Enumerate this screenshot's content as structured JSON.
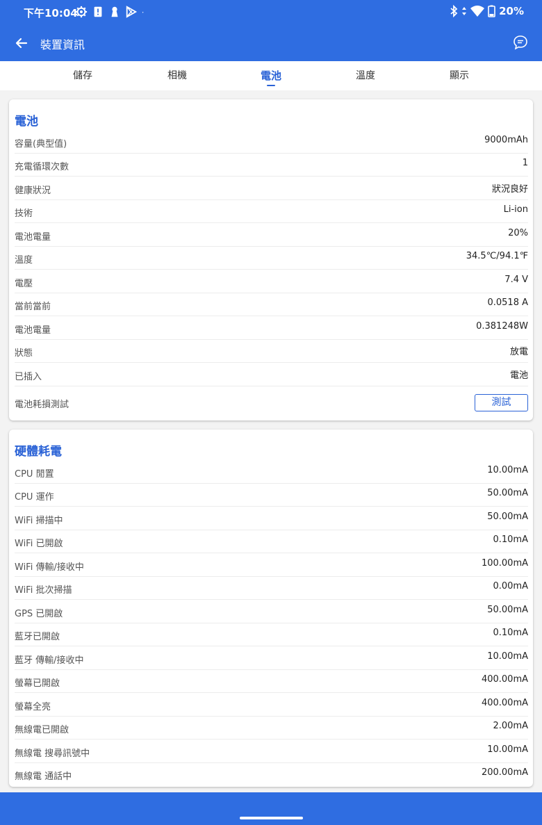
{
  "status": {
    "time": "下午10:04",
    "battery": "20%"
  },
  "app": {
    "title": "裝置資訊"
  },
  "tabs": [
    {
      "label": "儲存",
      "active": false
    },
    {
      "label": "相機",
      "active": false
    },
    {
      "label": "電池",
      "active": true
    },
    {
      "label": "溫度",
      "active": false
    },
    {
      "label": "顯示",
      "active": false
    }
  ],
  "battery": {
    "title": "電池",
    "rows": [
      {
        "label": "容量(典型值)",
        "value": "9000mAh"
      },
      {
        "label": "充電循環次數",
        "value": "1"
      },
      {
        "label": "健康狀況",
        "value": "狀況良好"
      },
      {
        "label": "技術",
        "value": "Li-ion"
      },
      {
        "label": "電池電量",
        "value": "20%"
      },
      {
        "label": "溫度",
        "value": "34.5℃/94.1℉"
      },
      {
        "label": "電壓",
        "value": "7.4 V"
      },
      {
        "label": "當前當前",
        "value": "0.0518 A"
      },
      {
        "label": "電池電量",
        "value": "0.381248W"
      },
      {
        "label": "狀態",
        "value": "放電"
      },
      {
        "label": "已插入",
        "value": "電池"
      }
    ],
    "test": {
      "label": "電池耗損測試",
      "button": "測試"
    }
  },
  "hardware": {
    "title": "硬體耗電",
    "rows": [
      {
        "label": "CPU 閒置",
        "value": "10.00mA"
      },
      {
        "label": "CPU 運作",
        "value": "50.00mA"
      },
      {
        "label": "WiFi 掃描中",
        "value": "50.00mA"
      },
      {
        "label": "WiFi 已開啟",
        "value": "0.10mA"
      },
      {
        "label": "WiFi 傳輸/接收中",
        "value": "100.00mA"
      },
      {
        "label": "WiFi 批次掃描",
        "value": "0.00mA"
      },
      {
        "label": "GPS 已開啟",
        "value": "50.00mA"
      },
      {
        "label": "藍牙已開啟",
        "value": "0.10mA"
      },
      {
        "label": "藍牙 傳輸/接收中",
        "value": "10.00mA"
      },
      {
        "label": "螢幕已開啟",
        "value": "400.00mA"
      },
      {
        "label": "螢幕全亮",
        "value": "400.00mA"
      },
      {
        "label": "無線電已開啟",
        "value": "2.00mA"
      },
      {
        "label": "無線電 搜尋訊號中",
        "value": "10.00mA"
      },
      {
        "label": "無線電 通話中",
        "value": "200.00mA"
      }
    ]
  }
}
